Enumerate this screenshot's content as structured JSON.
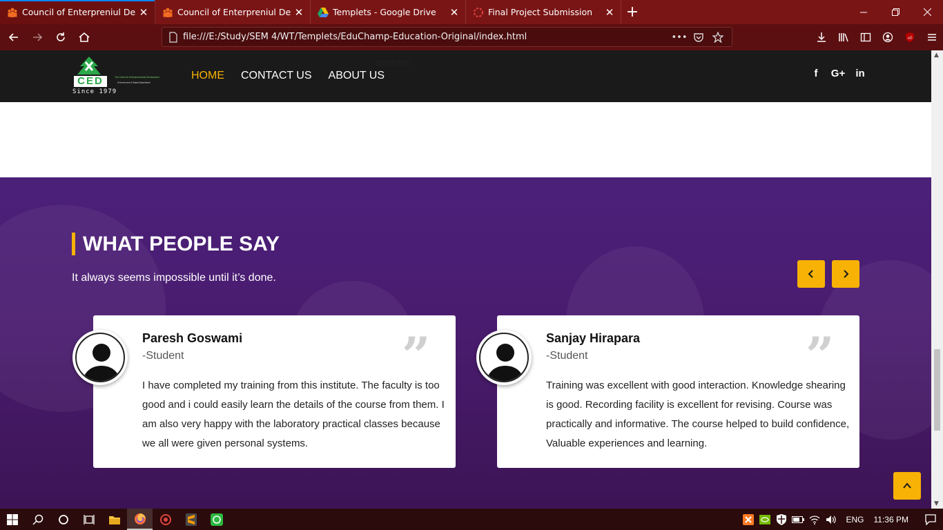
{
  "browser": {
    "tabs": [
      {
        "title": "Council of Enterpreniul Devlopme",
        "active": true,
        "icon": "people-favicon"
      },
      {
        "title": "Council of Enterpreniul Devlopme",
        "active": false,
        "icon": "people-favicon"
      },
      {
        "title": "Templets - Google Drive",
        "active": false,
        "icon": "google-drive-icon"
      },
      {
        "title": "Final Project Submission",
        "active": false,
        "icon": "loading-icon"
      }
    ],
    "url": "file:///E:/Study/SEM 4/WT/Templets/EduChamp-Education-Original/index.html"
  },
  "site": {
    "logo_text": "CED",
    "logo_tagline": "The Center for Entrepreneurship Development",
    "logo_subtagline": "(A Government of Gujarat Organization)",
    "logo_since": "Since 1979",
    "ghost_text": "operate!",
    "nav": {
      "home": "HOME",
      "contact": "CONTACT US",
      "about": "ABOUT US"
    },
    "social": {
      "facebook": "f",
      "google": "G+",
      "linkedin": "in"
    }
  },
  "testimonials": {
    "title_bold": "WHAT PEOPLE",
    "title_light": "SAY",
    "subtitle": "It always seems impossible until it’s done.",
    "cards": [
      {
        "name": "Paresh Goswami",
        "role": "-Student",
        "text": "I have completed my training from this institute. The faculty is too good and i could easily learn the details of the course from them. I am also very happy with the laboratory practical classes because we all were given personal systems."
      },
      {
        "name": "Sanjay Hirapara",
        "role": "-Student",
        "text": "Training was excellent with good interaction. Knowledge shearing is good. Recording facility is excellent for revising. Course was practically and informative. The course helped to build confidence, Valuable experiences and learning."
      }
    ]
  },
  "taskbar": {
    "language": "ENG",
    "time": "11:36 PM"
  },
  "colors": {
    "accent": "#f7b205",
    "browser_chrome": "#7a1516",
    "section_bg": "#4b2079"
  }
}
